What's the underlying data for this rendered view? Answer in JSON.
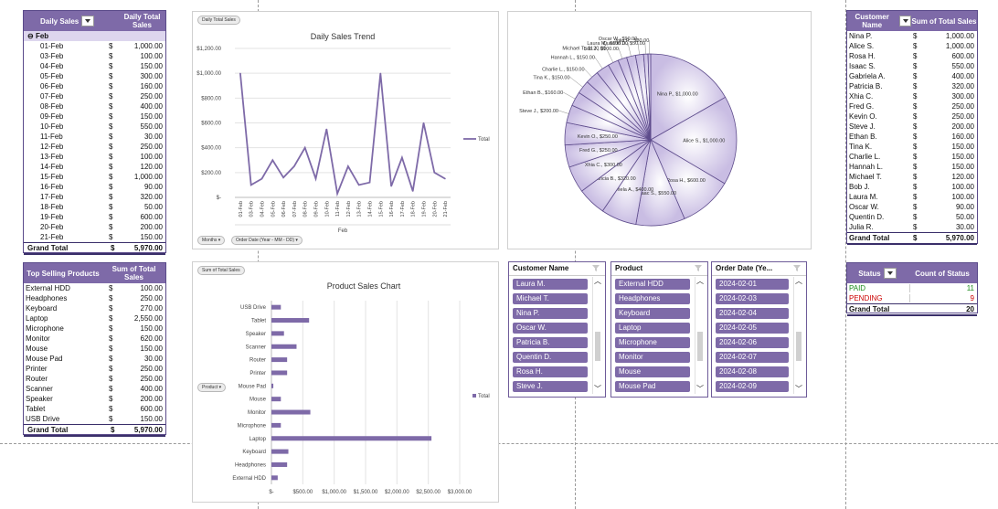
{
  "daily_table": {
    "row_label": "Daily Sales",
    "value_label": "Daily Total Sales",
    "group": "Feb",
    "rows": [
      [
        "01-Feb",
        "$",
        "1,000.00"
      ],
      [
        "03-Feb",
        "$",
        "100.00"
      ],
      [
        "04-Feb",
        "$",
        "150.00"
      ],
      [
        "05-Feb",
        "$",
        "300.00"
      ],
      [
        "06-Feb",
        "$",
        "160.00"
      ],
      [
        "07-Feb",
        "$",
        "250.00"
      ],
      [
        "08-Feb",
        "$",
        "400.00"
      ],
      [
        "09-Feb",
        "$",
        "150.00"
      ],
      [
        "10-Feb",
        "$",
        "550.00"
      ],
      [
        "11-Feb",
        "$",
        "30.00"
      ],
      [
        "12-Feb",
        "$",
        "250.00"
      ],
      [
        "13-Feb",
        "$",
        "100.00"
      ],
      [
        "14-Feb",
        "$",
        "120.00"
      ],
      [
        "15-Feb",
        "$",
        "1,000.00"
      ],
      [
        "16-Feb",
        "$",
        "90.00"
      ],
      [
        "17-Feb",
        "$",
        "320.00"
      ],
      [
        "18-Feb",
        "$",
        "50.00"
      ],
      [
        "19-Feb",
        "$",
        "600.00"
      ],
      [
        "20-Feb",
        "$",
        "200.00"
      ],
      [
        "21-Feb",
        "$",
        "150.00"
      ]
    ],
    "total_label": "Grand Total",
    "total_cur": "$",
    "total_value": "5,970.00"
  },
  "products_table": {
    "row_label": "Top Selling Products",
    "value_label": "Sum of Total Sales",
    "rows": [
      [
        "External HDD",
        "$",
        "100.00"
      ],
      [
        "Headphones",
        "$",
        "250.00"
      ],
      [
        "Keyboard",
        "$",
        "270.00"
      ],
      [
        "Laptop",
        "$",
        "2,550.00"
      ],
      [
        "Microphone",
        "$",
        "150.00"
      ],
      [
        "Monitor",
        "$",
        "620.00"
      ],
      [
        "Mouse",
        "$",
        "150.00"
      ],
      [
        "Mouse Pad",
        "$",
        "30.00"
      ],
      [
        "Printer",
        "$",
        "250.00"
      ],
      [
        "Router",
        "$",
        "250.00"
      ],
      [
        "Scanner",
        "$",
        "400.00"
      ],
      [
        "Speaker",
        "$",
        "200.00"
      ],
      [
        "Tablet",
        "$",
        "600.00"
      ],
      [
        "USB Drive",
        "$",
        "150.00"
      ]
    ],
    "total_label": "Grand Total",
    "total_cur": "$",
    "total_value": "5,970.00"
  },
  "customers_table": {
    "row_label": "Customer Name",
    "value_label": "Sum of Total Sales",
    "rows": [
      [
        "Nina P.",
        "$",
        "1,000.00"
      ],
      [
        "Alice S.",
        "$",
        "1,000.00"
      ],
      [
        "Rosa H.",
        "$",
        "600.00"
      ],
      [
        "Isaac S.",
        "$",
        "550.00"
      ],
      [
        "Gabriela A.",
        "$",
        "400.00"
      ],
      [
        "Patricia B.",
        "$",
        "320.00"
      ],
      [
        "Xhia C.",
        "$",
        "300.00"
      ],
      [
        "Fred G.",
        "$",
        "250.00"
      ],
      [
        "Kevin O.",
        "$",
        "250.00"
      ],
      [
        "Steve J.",
        "$",
        "200.00"
      ],
      [
        "Ethan B.",
        "$",
        "160.00"
      ],
      [
        "Tina K.",
        "$",
        "150.00"
      ],
      [
        "Charlie L.",
        "$",
        "150.00"
      ],
      [
        "Hannah L.",
        "$",
        "150.00"
      ],
      [
        "Michael T.",
        "$",
        "120.00"
      ],
      [
        "Bob J.",
        "$",
        "100.00"
      ],
      [
        "Laura M.",
        "$",
        "100.00"
      ],
      [
        "Oscar W.",
        "$",
        "90.00"
      ],
      [
        "Quentin D.",
        "$",
        "50.00"
      ],
      [
        "Julia R.",
        "$",
        "30.00"
      ]
    ],
    "total_label": "Grand Total",
    "total_cur": "$",
    "total_value": "5,970.00"
  },
  "status_table": {
    "row_label": "Status",
    "value_label": "Count of Status",
    "rows": [
      {
        "label": "PAID",
        "value": "11",
        "color": "#1a8a1a"
      },
      {
        "label": "PENDING",
        "value": "9",
        "color": "#cc0000"
      }
    ],
    "total_label": "Grand Total",
    "total_value": "20"
  },
  "line_chart": {
    "field_button": "Daily Total Sales",
    "filter_months": "Months",
    "filter_date": "Order Date (Year - MM - DD)",
    "legend": "Total",
    "xgroup": "Feb"
  },
  "bar_chart": {
    "field_button": "Sum of Total Sales",
    "filter_product": "Product",
    "legend": "Total"
  },
  "slicers": {
    "customer": {
      "title": "Customer Name",
      "items": [
        "Laura M.",
        "Michael T.",
        "Nina P.",
        "Oscar W.",
        "Patricia B.",
        "Quentin D.",
        "Rosa H.",
        "Steve J."
      ]
    },
    "product": {
      "title": "Product",
      "items": [
        "External HDD",
        "Headphones",
        "Keyboard",
        "Laptop",
        "Microphone",
        "Monitor",
        "Mouse",
        "Mouse Pad"
      ]
    },
    "date": {
      "title": "Order Date (Ye...",
      "items": [
        "2024-02-01",
        "2024-02-03",
        "2024-02-04",
        "2024-02-05",
        "2024-02-06",
        "2024-02-07",
        "2024-02-08",
        "2024-02-09"
      ]
    }
  },
  "chart_data": [
    {
      "type": "line",
      "title": "Daily Sales Trend",
      "xlabel": "Feb",
      "ylabel": "",
      "x": [
        "01-Feb",
        "03-Feb",
        "04-Feb",
        "05-Feb",
        "06-Feb",
        "07-Feb",
        "08-Feb",
        "09-Feb",
        "10-Feb",
        "11-Feb",
        "12-Feb",
        "13-Feb",
        "14-Feb",
        "15-Feb",
        "16-Feb",
        "17-Feb",
        "18-Feb",
        "19-Feb",
        "20-Feb",
        "21-Feb"
      ],
      "series": [
        {
          "name": "Total",
          "values": [
            1000,
            100,
            150,
            300,
            160,
            250,
            400,
            150,
            550,
            30,
            250,
            100,
            120,
            1000,
            90,
            320,
            50,
            600,
            200,
            150
          ]
        }
      ],
      "yticks": [
        "$-",
        "$200.00",
        "$400.00",
        "$600.00",
        "$800.00",
        "$1,000.00",
        "$1,200.00"
      ],
      "ylim": [
        0,
        1200
      ],
      "color": "#7e6aa8",
      "grid": true,
      "legend": "right"
    },
    {
      "type": "pie",
      "labels": [
        "Nina P.",
        "Alice S.",
        "Rosa H.",
        "Isaac S.",
        "Gabriela A.",
        "Patricia B.",
        "Xhia C.",
        "Fred G.",
        "Kevin O.",
        "Steve J.",
        "Ethan B.",
        "Tina K.",
        "Charlie L.",
        "Hannah L.",
        "Michael T.",
        "Bob J.",
        "Laura M.",
        "Oscar W.",
        "Quentin D.",
        "Julia R."
      ],
      "values": [
        1000,
        1000,
        600,
        550,
        400,
        320,
        300,
        250,
        250,
        200,
        160,
        150,
        150,
        150,
        120,
        100,
        100,
        90,
        50,
        30
      ],
      "value_labels": [
        "$1,000.00",
        "$1,000.00",
        "$600.00",
        "$550.00",
        "$400.00",
        "$320.00",
        "$300.00",
        "$250.00",
        "$250.00",
        "$200.00",
        "$160.00",
        "$150.00",
        "$150.00",
        "$150.00",
        "$120.00",
        "$100.00",
        "$100.00",
        "$90.00",
        "$50.00",
        "$30.00"
      ],
      "color": "#7e6aa8"
    },
    {
      "type": "bar",
      "orientation": "horizontal",
      "title": "Product Sales Chart",
      "categories": [
        "USB Drive",
        "Tablet",
        "Speaker",
        "Scanner",
        "Router",
        "Printer",
        "Mouse Pad",
        "Mouse",
        "Monitor",
        "Microphone",
        "Laptop",
        "Keyboard",
        "Headphones",
        "External HDD"
      ],
      "series": [
        {
          "name": "Total",
          "values": [
            150,
            600,
            200,
            400,
            250,
            250,
            30,
            150,
            620,
            150,
            2550,
            270,
            250,
            100
          ]
        }
      ],
      "xticks": [
        "$-",
        "$500.00",
        "$1,000.00",
        "$1,500.00",
        "$2,000.00",
        "$2,500.00",
        "$3,000.00"
      ],
      "xlim": [
        0,
        3000
      ],
      "color": "#7e6aa8",
      "grid": true,
      "legend": "right"
    }
  ]
}
